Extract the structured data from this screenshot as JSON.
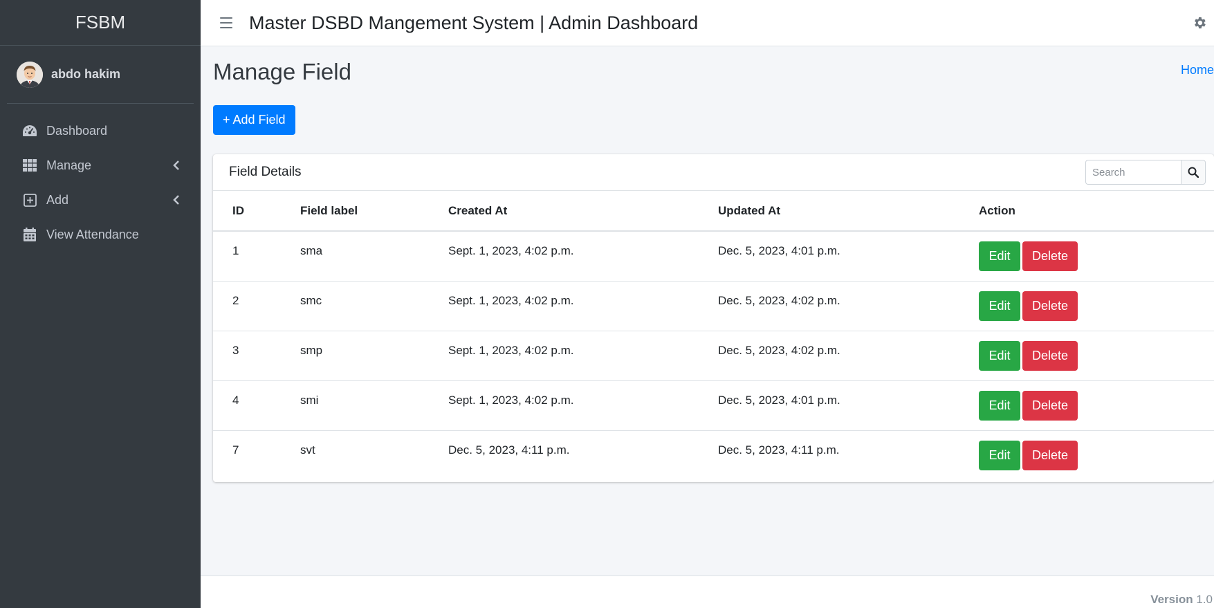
{
  "sidebar": {
    "brand": "FSBM",
    "user": {
      "name": "abdo hakim"
    },
    "items": [
      {
        "label": "Dashboard",
        "icon": "dashboard-icon",
        "has_children": false
      },
      {
        "label": "Manage",
        "icon": "grid-icon",
        "has_children": true
      },
      {
        "label": "Add",
        "icon": "plus-square-icon",
        "has_children": true
      },
      {
        "label": "View Attendance",
        "icon": "calendar-icon",
        "has_children": false
      }
    ]
  },
  "header": {
    "title": "Master DSBD Mangement System | Admin Dashboard"
  },
  "page": {
    "title": "Manage Field",
    "breadcrumb": "Home",
    "add_button": "+ Add Field"
  },
  "card": {
    "title": "Field Details",
    "search_placeholder": "Search",
    "columns": [
      "ID",
      "Field label",
      "Created At",
      "Updated At",
      "Action"
    ],
    "rows": [
      {
        "id": "1",
        "label": "sma",
        "created": "Sept. 1, 2023, 4:02 p.m.",
        "updated": "Dec. 5, 2023, 4:01 p.m."
      },
      {
        "id": "2",
        "label": "smc",
        "created": "Sept. 1, 2023, 4:02 p.m.",
        "updated": "Dec. 5, 2023, 4:02 p.m."
      },
      {
        "id": "3",
        "label": "smp",
        "created": "Sept. 1, 2023, 4:02 p.m.",
        "updated": "Dec. 5, 2023, 4:02 p.m."
      },
      {
        "id": "4",
        "label": "smi",
        "created": "Sept. 1, 2023, 4:02 p.m.",
        "updated": "Dec. 5, 2023, 4:01 p.m."
      },
      {
        "id": "7",
        "label": "svt",
        "created": "Dec. 5, 2023, 4:11 p.m.",
        "updated": "Dec. 5, 2023, 4:11 p.m."
      }
    ],
    "edit_label": "Edit",
    "delete_label": "Delete"
  },
  "footer": {
    "version_label": "Version",
    "version_number": "1.0"
  },
  "colors": {
    "sidebar_bg": "#343a40",
    "primary": "#007bff",
    "success": "#28a745",
    "danger": "#dc3545",
    "content_bg": "#f4f6f9"
  }
}
